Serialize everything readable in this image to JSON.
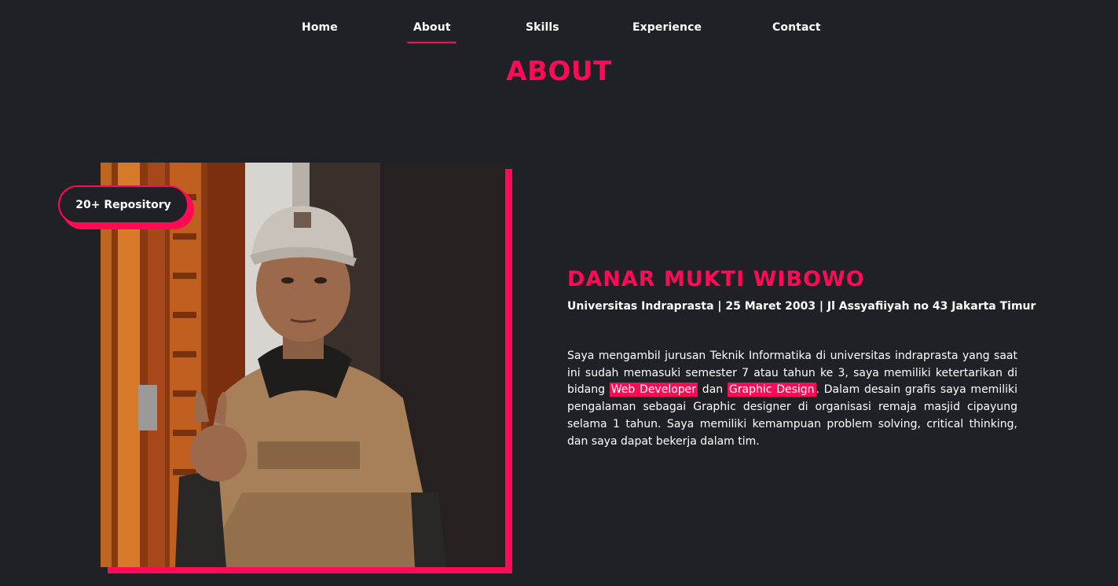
{
  "nav": {
    "items": [
      {
        "label": "Home"
      },
      {
        "label": "About"
      },
      {
        "label": "Skills"
      },
      {
        "label": "Experience"
      },
      {
        "label": "Contact"
      }
    ],
    "active": "About"
  },
  "section": {
    "title": "ABOUT"
  },
  "badge": {
    "label": "20+ Repository"
  },
  "profile": {
    "name": "DANAR MUKTI WIBOWO",
    "details": "Universitas Indraprasta | 25 Maret 2003 | Jl Assyafiiyah no 43 Jakarta Timur",
    "bio_part1": "Saya mengambil jurusan Teknik Informatika di universitas indraprasta yang saat ini sudah memasuki semester 7 atau tahun ke 3, saya memiliki ketertarikan di bidang ",
    "highlight1": "Web Developer",
    "bio_part2": " dan ",
    "highlight2": "Graphic Design",
    "bio_part3": ". Dalam desain grafis saya memiliki pengalaman sebagai Graphic designer di organisasi remaja masjid cipayung selama 1 tahun. Saya memiliki kemampuan problem solving, critical thinking, dan saya dapat bekerja dalam tim."
  },
  "colors": {
    "accent": "#ff0a54",
    "background": "#1f2126",
    "text": "#ffffff"
  }
}
